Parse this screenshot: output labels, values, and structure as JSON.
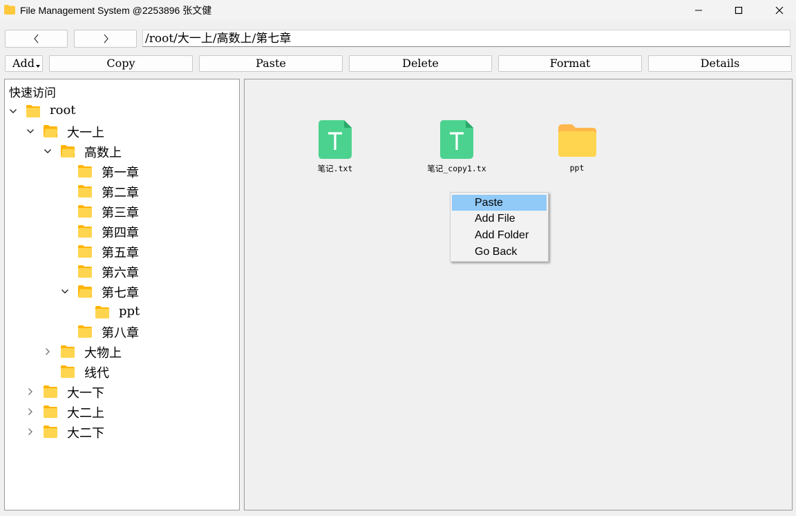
{
  "window": {
    "title": "File Management System @2253896 张文健",
    "icon": "folder-icon",
    "controls": [
      "minimize-icon",
      "maximize-icon",
      "close-icon"
    ]
  },
  "nav": {
    "back_icon": "chevron-left-icon",
    "forward_icon": "chevron-right-icon",
    "path": "/root/大一上/高数上/第七章"
  },
  "toolbar": {
    "add": "Add",
    "copy": "Copy",
    "paste": "Paste",
    "delete": "Delete",
    "format": "Format",
    "details": "Details"
  },
  "tree": {
    "header": "快速访问",
    "items": [
      {
        "label": "root",
        "state": "expanded"
      },
      {
        "label": "大一上",
        "state": "expanded"
      },
      {
        "label": "高数上",
        "state": "expanded"
      },
      {
        "label": "第一章",
        "state": "leaf"
      },
      {
        "label": "第二章",
        "state": "leaf"
      },
      {
        "label": "第三章",
        "state": "leaf"
      },
      {
        "label": "第四章",
        "state": "leaf"
      },
      {
        "label": "第五章",
        "state": "leaf"
      },
      {
        "label": "第六章",
        "state": "leaf"
      },
      {
        "label": "第七章",
        "state": "expanded"
      },
      {
        "label": "ppt",
        "state": "leaf"
      },
      {
        "label": "第八章",
        "state": "leaf"
      },
      {
        "label": "大物上",
        "state": "collapsed"
      },
      {
        "label": "线代",
        "state": "leaf"
      },
      {
        "label": "大一下",
        "state": "collapsed"
      },
      {
        "label": "大二上",
        "state": "collapsed"
      },
      {
        "label": "大二下",
        "state": "collapsed"
      }
    ]
  },
  "files": [
    {
      "name": "笔记.txt",
      "type": "text-file-icon",
      "display": "笔记.txt"
    },
    {
      "name": "笔记_copy1.txt",
      "type": "text-file-icon",
      "display": "笔记_copy1.tx"
    },
    {
      "name": "ppt",
      "type": "folder-icon",
      "display": "ppt"
    }
  ],
  "context_menu": {
    "items": [
      "Paste",
      "Add File",
      "Add Folder",
      "Go Back"
    ],
    "highlighted": "Paste"
  },
  "colors": {
    "folder": "#ffd54f",
    "folder_tab": "#ffb74d",
    "text_file": "#4cd28f",
    "menu_highlight": "#91c9f7"
  }
}
